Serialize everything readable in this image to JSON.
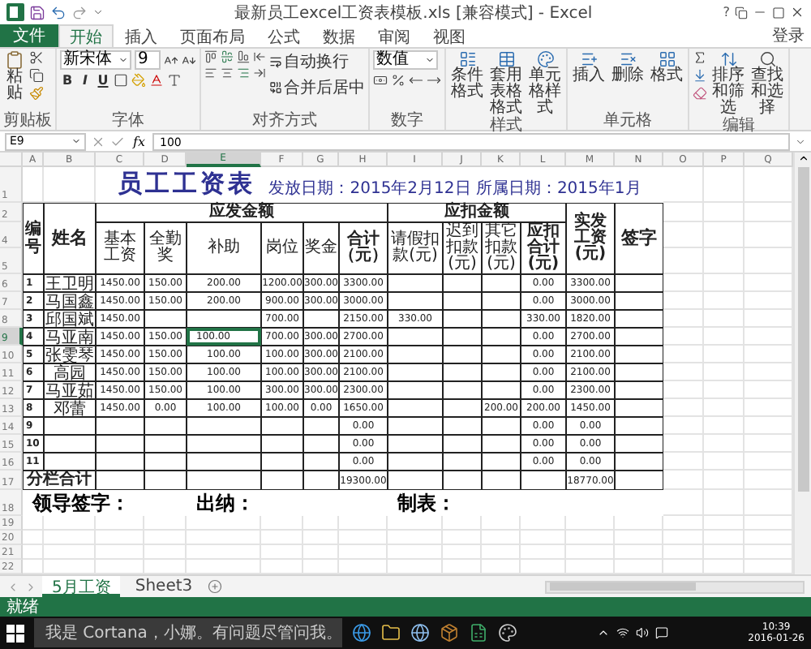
{
  "window": {
    "title": "最新员工excel工资表模板.xls [兼容模式] - Excel",
    "help": "?"
  },
  "ribbon_tabs": {
    "file": "文件",
    "account": "登录",
    "tabs": [
      {
        "label": "开始",
        "selected": true
      },
      {
        "label": "插入",
        "selected": false
      },
      {
        "label": "页面布局",
        "selected": false
      },
      {
        "label": "公式",
        "selected": false
      },
      {
        "label": "数据",
        "selected": false
      },
      {
        "label": "审阅",
        "selected": false
      },
      {
        "label": "视图",
        "selected": false
      }
    ]
  },
  "ribbon_groups": [
    {
      "kind": "clipboard",
      "label": "剪贴板",
      "buttons": [
        "粘贴"
      ]
    },
    {
      "kind": "font",
      "label": "字体",
      "font": "新宋体",
      "size": "9",
      "styles": [
        "B",
        "I",
        "U"
      ]
    },
    {
      "kind": "align",
      "label": "对齐方式",
      "buttons": [
        "自动换行",
        "合并后居中"
      ]
    },
    {
      "kind": "number",
      "label": "数字",
      "format": "数值"
    },
    {
      "kind": "styles",
      "label": "样式",
      "buttons": [
        "条件格式",
        "套用表格格式",
        "单元格样式"
      ]
    },
    {
      "kind": "cells",
      "label": "单元格",
      "buttons": [
        "插入",
        "删除",
        "格式"
      ]
    },
    {
      "kind": "edit",
      "label": "编辑",
      "buttons": [
        "排序和筛选",
        "查找和选择"
      ]
    }
  ],
  "formula_bar": {
    "cell": "E9",
    "function_label": "fx",
    "value": "100"
  },
  "sheet": {
    "columns": [
      {
        "label": "A",
        "selected": false
      },
      {
        "label": "B",
        "selected": false
      },
      {
        "label": "C",
        "selected": false
      },
      {
        "label": "D",
        "selected": false
      },
      {
        "label": "E",
        "selected": true
      },
      {
        "label": "F",
        "selected": false
      },
      {
        "label": "G",
        "selected": false
      },
      {
        "label": "H",
        "selected": false
      },
      {
        "label": "I",
        "selected": false
      },
      {
        "label": "J",
        "selected": false
      },
      {
        "label": "K",
        "selected": false
      },
      {
        "label": "L",
        "selected": false
      },
      {
        "label": "M",
        "selected": false
      },
      {
        "label": "N",
        "selected": false
      },
      {
        "label": "O",
        "selected": false
      },
      {
        "label": "P",
        "selected": false
      },
      {
        "label": "Q",
        "selected": false
      }
    ],
    "title_row": {
      "row_number": "1",
      "title": "员工工资表",
      "note": "发放日期：2015年2月12日  所属日期：2015年1月"
    },
    "header": {
      "row_numbers": [
        "2",
        "4",
        "5"
      ],
      "id": "编号",
      "name": "姓名",
      "pay_group": "应发金额",
      "pay_columns": [
        "基本工资",
        "全勤奖",
        "补助",
        "岗位",
        "奖金",
        "合计（元）"
      ],
      "deduct_group": "应扣金额",
      "deduct_columns": [
        "请假扣款(元)",
        "迟到扣款(元)",
        "其它扣款(元)",
        "应扣合计(元)"
      ],
      "net": "实发工资(元)",
      "sign": "签字"
    },
    "rows": [
      {
        "row_number": "6",
        "selected": false,
        "cells": [
          "1",
          "王卫明",
          "1450.00",
          "150.00",
          "200.00",
          "1200.00",
          "300.00",
          "3300.00",
          null,
          null,
          null,
          "0.00",
          "3300.00",
          null
        ]
      },
      {
        "row_number": "7",
        "selected": false,
        "cells": [
          "2",
          "马国鑫",
          "1450.00",
          "150.00",
          "200.00",
          "900.00",
          "300.00",
          "3000.00",
          null,
          null,
          null,
          "0.00",
          "3000.00",
          null
        ]
      },
      {
        "row_number": "8",
        "selected": false,
        "cells": [
          "3",
          "邱国斌",
          "1450.00",
          null,
          null,
          "700.00",
          null,
          "2150.00",
          "330.00",
          null,
          null,
          "330.00",
          "1820.00",
          null
        ]
      },
      {
        "row_number": "9",
        "selected": true,
        "cells": [
          "4",
          "马亚南",
          "1450.00",
          "150.00",
          "100.00",
          "700.00",
          "300.00",
          "2700.00",
          null,
          null,
          null,
          "0.00",
          "2700.00",
          null
        ]
      },
      {
        "row_number": "10",
        "selected": false,
        "cells": [
          "5",
          "张雯琴",
          "1450.00",
          "150.00",
          "100.00",
          "100.00",
          "300.00",
          "2100.00",
          null,
          null,
          null,
          "0.00",
          "2100.00",
          null
        ]
      },
      {
        "row_number": "11",
        "selected": false,
        "cells": [
          "6",
          "高园",
          "1450.00",
          "150.00",
          "100.00",
          "100.00",
          "300.00",
          "2100.00",
          null,
          null,
          null,
          "0.00",
          "2100.00",
          null
        ]
      },
      {
        "row_number": "12",
        "selected": false,
        "cells": [
          "7",
          "马亚茹",
          "1450.00",
          "150.00",
          "100.00",
          "300.00",
          "300.00",
          "2300.00",
          null,
          null,
          null,
          "0.00",
          "2300.00",
          null
        ]
      },
      {
        "row_number": "13",
        "selected": false,
        "cells": [
          "8",
          "邓蕾",
          "1450.00",
          "0.00",
          "100.00",
          "100.00",
          "0.00",
          "1650.00",
          null,
          null,
          "200.00",
          "200.00",
          "1450.00",
          null
        ]
      },
      {
        "row_number": "14",
        "selected": false,
        "cells": [
          "9",
          null,
          null,
          null,
          null,
          null,
          null,
          "0.00",
          null,
          null,
          null,
          "0.00",
          "0.00",
          null
        ]
      },
      {
        "row_number": "15",
        "selected": false,
        "cells": [
          "10",
          null,
          null,
          null,
          null,
          null,
          null,
          "0.00",
          null,
          null,
          null,
          "0.00",
          "0.00",
          null
        ]
      },
      {
        "row_number": "16",
        "selected": false,
        "cells": [
          "11",
          null,
          null,
          null,
          null,
          null,
          null,
          "0.00",
          null,
          null,
          null,
          "0.00",
          "0.00",
          null
        ]
      }
    ],
    "total_row": {
      "row_number": "17",
      "label": "分栏合计",
      "cells": [
        null,
        null,
        null,
        null,
        null,
        "19300.00",
        null,
        null,
        null,
        null,
        "18770.00",
        null
      ]
    },
    "signature_row": {
      "row_number": "18",
      "labels": [
        "领导签字：",
        "出纳：",
        "制表："
      ]
    },
    "empty_rows": [
      "19",
      "20",
      "21",
      "22"
    ]
  },
  "sheet_tabs": [
    {
      "label": "5月工资",
      "selected": true
    },
    {
      "label": "Sheet3",
      "selected": false
    }
  ],
  "status_bar": {
    "text": "就绪"
  },
  "taskbar": {
    "search": "我是 Cortana，小娜。有问题尽管问我。",
    "time": "10:39",
    "date": "2016-01-26"
  }
}
